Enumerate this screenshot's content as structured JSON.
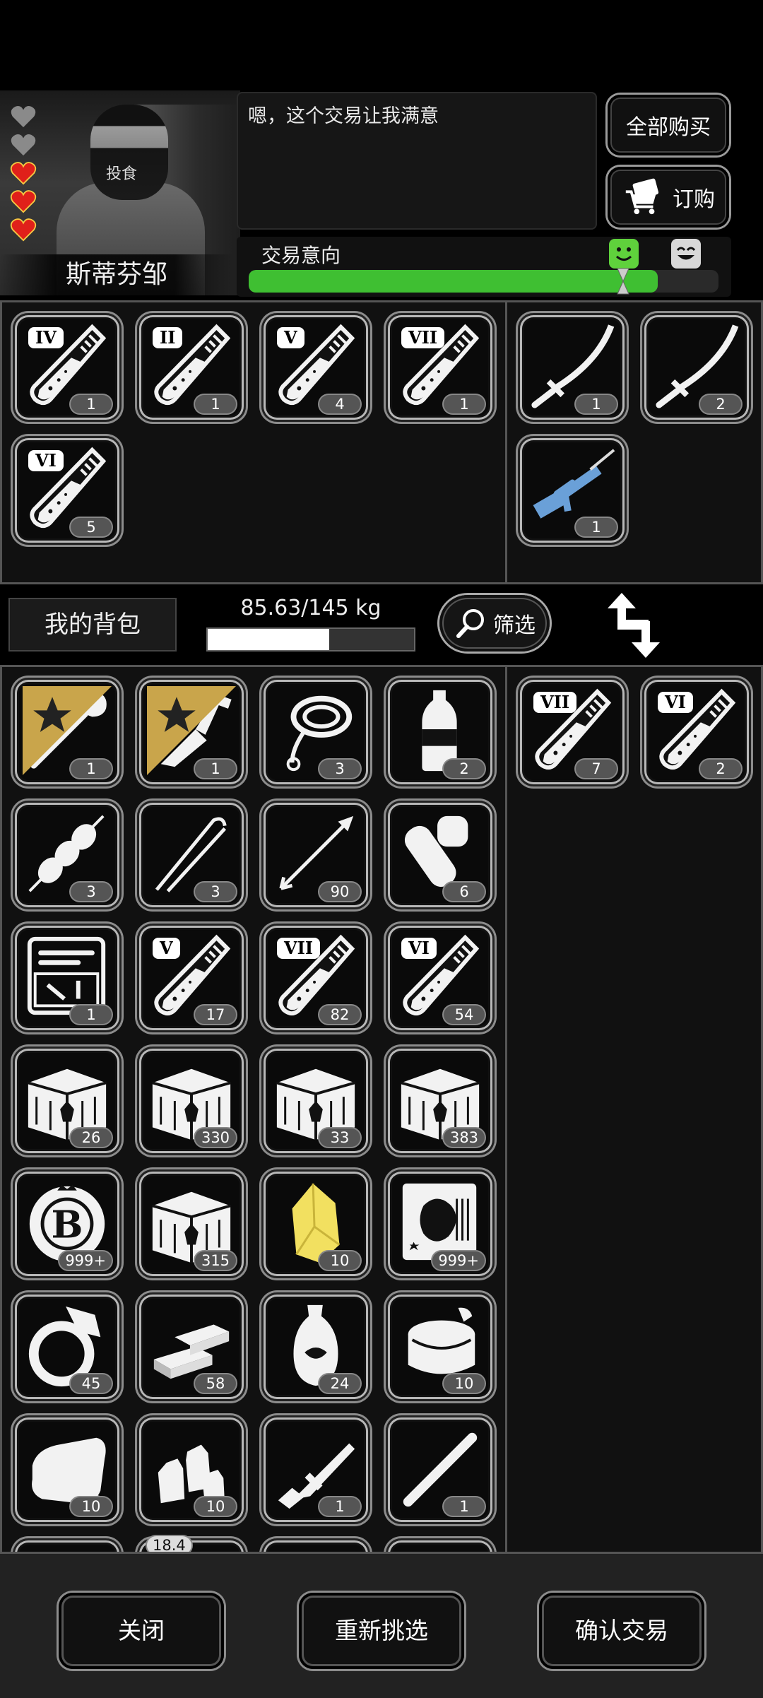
{
  "npc": {
    "name": "斯蒂芬邹",
    "mask_text": "投食",
    "dialog": "嗯，这个交易让我满意",
    "hearts": [
      {
        "state": "empty",
        "color": "#8a8a8a"
      },
      {
        "state": "empty",
        "color": "#8a8a8a"
      },
      {
        "state": "full",
        "color": "#e0201a"
      },
      {
        "state": "full",
        "color": "#e0201a"
      },
      {
        "state": "full",
        "color": "#e0201a"
      }
    ]
  },
  "header_buttons": {
    "buy_all": "全部购买",
    "order": "订购"
  },
  "trade_intent": {
    "label": "交易意向",
    "progress": 0.87,
    "fill_color": "#3fbf32",
    "faces": [
      "happy-face-icon",
      "grin-face-icon"
    ]
  },
  "merchant_consumables": [
    {
      "icon": "test-tube-icon",
      "tier": "IV",
      "count": "1"
    },
    {
      "icon": "test-tube-icon",
      "tier": "II",
      "count": "1"
    },
    {
      "icon": "test-tube-icon",
      "tier": "V",
      "count": "4"
    },
    {
      "icon": "test-tube-icon",
      "tier": "VII",
      "count": "1"
    },
    {
      "icon": "test-tube-icon",
      "tier": "VI",
      "count": "5"
    }
  ],
  "merchant_gear": [
    {
      "icon": "katana-icon",
      "count": "1"
    },
    {
      "icon": "katana-icon",
      "count": "2"
    },
    {
      "icon": "sniper-rifle-icon",
      "count": "1",
      "color": "#6aa0d8"
    }
  ],
  "backpack_bar": {
    "label": "我的背包",
    "weight": "85.63/145 kg",
    "weight_fraction": 0.59,
    "filter": "筛选"
  },
  "backpack_items": [
    {
      "icon": "shovel-icon",
      "count": "1",
      "starred": true
    },
    {
      "icon": "multitool-icon",
      "count": "1",
      "starred": true
    },
    {
      "icon": "rope-icon",
      "count": "3"
    },
    {
      "icon": "water-bottle-icon",
      "count": "2"
    },
    {
      "icon": "kebab-icon",
      "count": "3"
    },
    {
      "icon": "tweezers-icon",
      "count": "3"
    },
    {
      "icon": "arrow-icon",
      "count": "90"
    },
    {
      "icon": "bandage-icon",
      "count": "6"
    },
    {
      "icon": "toolkit-icon",
      "count": "1"
    },
    {
      "icon": "test-tube-icon",
      "tier": "V",
      "count": "17"
    },
    {
      "icon": "test-tube-icon",
      "tier": "VII",
      "count": "82"
    },
    {
      "icon": "test-tube-icon",
      "tier": "VI",
      "count": "54"
    },
    {
      "icon": "crate-icon",
      "count": "26"
    },
    {
      "icon": "crate-icon",
      "count": "330"
    },
    {
      "icon": "crate-icon",
      "count": "33"
    },
    {
      "icon": "crate-icon",
      "count": "383"
    },
    {
      "icon": "b-chip-icon",
      "count": "999+"
    },
    {
      "icon": "crate-icon",
      "count": "315"
    },
    {
      "icon": "gem-icon",
      "count": "10",
      "color": "#f2e060"
    },
    {
      "icon": "card-icon",
      "count": "999+"
    },
    {
      "icon": "ring-icon",
      "count": "45"
    },
    {
      "icon": "gold-bars-icon",
      "count": "58"
    },
    {
      "icon": "vase-icon",
      "count": "24"
    },
    {
      "icon": "canned-food-icon",
      "count": "10"
    },
    {
      "icon": "bread-icon",
      "count": "10"
    },
    {
      "icon": "potion-bottles-icon",
      "count": "10"
    },
    {
      "icon": "rifle-icon",
      "count": "1"
    },
    {
      "icon": "stick-icon",
      "count": "1"
    }
  ],
  "backpack_partial_label": "18.4",
  "offer_items": [
    {
      "icon": "test-tube-icon",
      "tier": "VII",
      "count": "7"
    },
    {
      "icon": "test-tube-icon",
      "tier": "VI",
      "count": "2"
    }
  ],
  "footer": {
    "close": "关闭",
    "reselect": "重新挑选",
    "confirm": "确认交易"
  }
}
